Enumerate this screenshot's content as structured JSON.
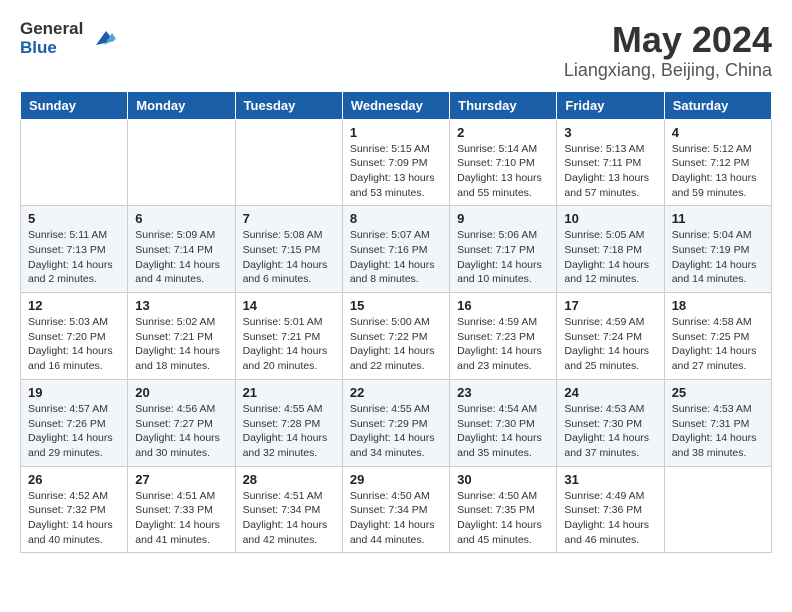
{
  "header": {
    "logo": {
      "text_general": "General",
      "text_blue": "Blue"
    },
    "title": "May 2024",
    "location": "Liangxiang, Beijing, China"
  },
  "days_of_week": [
    "Sunday",
    "Monday",
    "Tuesday",
    "Wednesday",
    "Thursday",
    "Friday",
    "Saturday"
  ],
  "weeks": [
    [
      {
        "day": "",
        "info": ""
      },
      {
        "day": "",
        "info": ""
      },
      {
        "day": "",
        "info": ""
      },
      {
        "day": "1",
        "info": "Sunrise: 5:15 AM\nSunset: 7:09 PM\nDaylight: 13 hours and 53 minutes."
      },
      {
        "day": "2",
        "info": "Sunrise: 5:14 AM\nSunset: 7:10 PM\nDaylight: 13 hours and 55 minutes."
      },
      {
        "day": "3",
        "info": "Sunrise: 5:13 AM\nSunset: 7:11 PM\nDaylight: 13 hours and 57 minutes."
      },
      {
        "day": "4",
        "info": "Sunrise: 5:12 AM\nSunset: 7:12 PM\nDaylight: 13 hours and 59 minutes."
      }
    ],
    [
      {
        "day": "5",
        "info": "Sunrise: 5:11 AM\nSunset: 7:13 PM\nDaylight: 14 hours and 2 minutes."
      },
      {
        "day": "6",
        "info": "Sunrise: 5:09 AM\nSunset: 7:14 PM\nDaylight: 14 hours and 4 minutes."
      },
      {
        "day": "7",
        "info": "Sunrise: 5:08 AM\nSunset: 7:15 PM\nDaylight: 14 hours and 6 minutes."
      },
      {
        "day": "8",
        "info": "Sunrise: 5:07 AM\nSunset: 7:16 PM\nDaylight: 14 hours and 8 minutes."
      },
      {
        "day": "9",
        "info": "Sunrise: 5:06 AM\nSunset: 7:17 PM\nDaylight: 14 hours and 10 minutes."
      },
      {
        "day": "10",
        "info": "Sunrise: 5:05 AM\nSunset: 7:18 PM\nDaylight: 14 hours and 12 minutes."
      },
      {
        "day": "11",
        "info": "Sunrise: 5:04 AM\nSunset: 7:19 PM\nDaylight: 14 hours and 14 minutes."
      }
    ],
    [
      {
        "day": "12",
        "info": "Sunrise: 5:03 AM\nSunset: 7:20 PM\nDaylight: 14 hours and 16 minutes."
      },
      {
        "day": "13",
        "info": "Sunrise: 5:02 AM\nSunset: 7:21 PM\nDaylight: 14 hours and 18 minutes."
      },
      {
        "day": "14",
        "info": "Sunrise: 5:01 AM\nSunset: 7:21 PM\nDaylight: 14 hours and 20 minutes."
      },
      {
        "day": "15",
        "info": "Sunrise: 5:00 AM\nSunset: 7:22 PM\nDaylight: 14 hours and 22 minutes."
      },
      {
        "day": "16",
        "info": "Sunrise: 4:59 AM\nSunset: 7:23 PM\nDaylight: 14 hours and 23 minutes."
      },
      {
        "day": "17",
        "info": "Sunrise: 4:59 AM\nSunset: 7:24 PM\nDaylight: 14 hours and 25 minutes."
      },
      {
        "day": "18",
        "info": "Sunrise: 4:58 AM\nSunset: 7:25 PM\nDaylight: 14 hours and 27 minutes."
      }
    ],
    [
      {
        "day": "19",
        "info": "Sunrise: 4:57 AM\nSunset: 7:26 PM\nDaylight: 14 hours and 29 minutes."
      },
      {
        "day": "20",
        "info": "Sunrise: 4:56 AM\nSunset: 7:27 PM\nDaylight: 14 hours and 30 minutes."
      },
      {
        "day": "21",
        "info": "Sunrise: 4:55 AM\nSunset: 7:28 PM\nDaylight: 14 hours and 32 minutes."
      },
      {
        "day": "22",
        "info": "Sunrise: 4:55 AM\nSunset: 7:29 PM\nDaylight: 14 hours and 34 minutes."
      },
      {
        "day": "23",
        "info": "Sunrise: 4:54 AM\nSunset: 7:30 PM\nDaylight: 14 hours and 35 minutes."
      },
      {
        "day": "24",
        "info": "Sunrise: 4:53 AM\nSunset: 7:30 PM\nDaylight: 14 hours and 37 minutes."
      },
      {
        "day": "25",
        "info": "Sunrise: 4:53 AM\nSunset: 7:31 PM\nDaylight: 14 hours and 38 minutes."
      }
    ],
    [
      {
        "day": "26",
        "info": "Sunrise: 4:52 AM\nSunset: 7:32 PM\nDaylight: 14 hours and 40 minutes."
      },
      {
        "day": "27",
        "info": "Sunrise: 4:51 AM\nSunset: 7:33 PM\nDaylight: 14 hours and 41 minutes."
      },
      {
        "day": "28",
        "info": "Sunrise: 4:51 AM\nSunset: 7:34 PM\nDaylight: 14 hours and 42 minutes."
      },
      {
        "day": "29",
        "info": "Sunrise: 4:50 AM\nSunset: 7:34 PM\nDaylight: 14 hours and 44 minutes."
      },
      {
        "day": "30",
        "info": "Sunrise: 4:50 AM\nSunset: 7:35 PM\nDaylight: 14 hours and 45 minutes."
      },
      {
        "day": "31",
        "info": "Sunrise: 4:49 AM\nSunset: 7:36 PM\nDaylight: 14 hours and 46 minutes."
      },
      {
        "day": "",
        "info": ""
      }
    ]
  ]
}
